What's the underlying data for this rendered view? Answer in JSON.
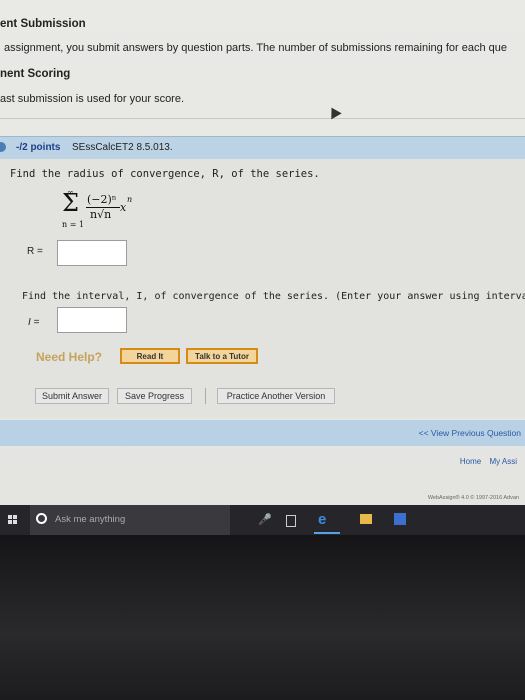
{
  "sections": {
    "submission_heading": "ent Submission",
    "submission_text": "assignment, you submit answers by question parts. The number of submissions remaining for each que",
    "scoring_heading": "nent Scoring",
    "scoring_text": "ast submission is used for your score."
  },
  "question": {
    "points": "-/2 points",
    "code": "SEssCalcET2 8.5.013.",
    "part1_prompt": "Find the radius of convergence, R, of the series.",
    "series": {
      "upper": "∞",
      "lower": "n = 1",
      "numerator": "(−2)ⁿ",
      "denominator": "n√n",
      "x": "x",
      "exp": "n",
      "sigma": "Σ"
    },
    "r_label": "R =",
    "part2_prompt": "Find the interval, I, of convergence of the series. (Enter your answer using interval notation.)",
    "i_label": "I ="
  },
  "help": {
    "label": "Need Help?",
    "read_it": "Read It",
    "talk_tutor": "Talk to a Tutor"
  },
  "actions": {
    "submit": "Submit Answer",
    "save": "Save Progress",
    "practice": "Practice Another Version"
  },
  "nav": {
    "view_previous": "<< View Previous Question",
    "home": "Home",
    "my_assignments": "My Assi"
  },
  "footer": {
    "copyright": "WebAssign® 4.0 © 1997-2016 Advan"
  },
  "taskbar": {
    "search_placeholder": "Ask me anything"
  }
}
